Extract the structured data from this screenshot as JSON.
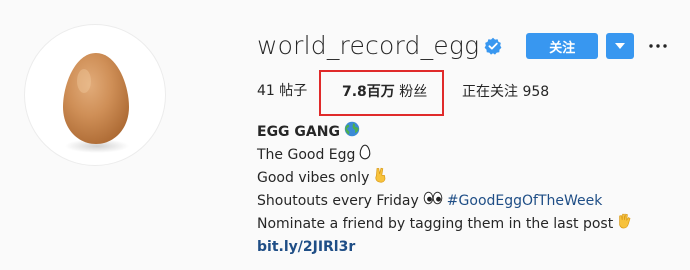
{
  "profile": {
    "username": "world_record_egg",
    "follow_label": "关注",
    "icons": {
      "verified": "verified-badge-icon",
      "dropdown": "chevron-down-icon",
      "more": "more-horizontal-icon",
      "avatar": "egg-photo"
    }
  },
  "stats": {
    "posts_count": "41",
    "posts_label": "帖子",
    "followers_count": "7.8百万",
    "followers_label": "粉丝",
    "following_label": "正在关注",
    "following_count": "958"
  },
  "bio": {
    "name": "EGG GANG",
    "line1": "The Good Egg",
    "line2": "Good vibes only",
    "line3": "Shoutouts every Friday",
    "line3_hashtag": "#GoodEggOfTheWeek",
    "line4": "Nominate a friend by tagging them in the last post",
    "link": "bit.ly/2JIRl3r"
  },
  "colors": {
    "accent": "#3897f0",
    "link": "#1f4e86",
    "highlight_box": "#e02a2a",
    "egg": "#c98a52"
  }
}
